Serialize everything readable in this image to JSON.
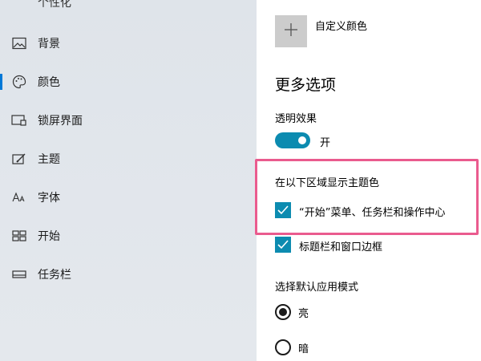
{
  "sidebar": {
    "header": "个性化",
    "items": [
      {
        "label": "背景",
        "icon": "picture-icon"
      },
      {
        "label": "颜色",
        "icon": "palette-icon",
        "active": true
      },
      {
        "label": "锁屏界面",
        "icon": "lock-screen-icon"
      },
      {
        "label": "主题",
        "icon": "theme-brush-icon"
      },
      {
        "label": "字体",
        "icon": "font-icon"
      },
      {
        "label": "开始",
        "icon": "start-tiles-icon"
      },
      {
        "label": "任务栏",
        "icon": "taskbar-icon"
      }
    ]
  },
  "main": {
    "custom_color": {
      "label": "自定义颜色",
      "icon": "plus-icon"
    },
    "more_options_title": "更多选项",
    "transparency": {
      "label": "透明效果",
      "state": "开",
      "on": true
    },
    "accent_surfaces": {
      "title": "在以下区域显示主题色",
      "options": [
        {
          "label": "“开始”菜单、任务栏和操作中心",
          "checked": true
        },
        {
          "label": "标题栏和窗口边框",
          "checked": true
        }
      ]
    },
    "app_mode": {
      "title": "选择默认应用模式",
      "options": [
        {
          "label": "亮",
          "selected": true
        },
        {
          "label": "暗",
          "selected": false
        }
      ]
    }
  },
  "colors": {
    "accent": "#0c8bb0",
    "highlight_box": "#ea5b8e",
    "sidebar_bg": "#e2e6eb",
    "active_indicator": "#0078d7"
  }
}
